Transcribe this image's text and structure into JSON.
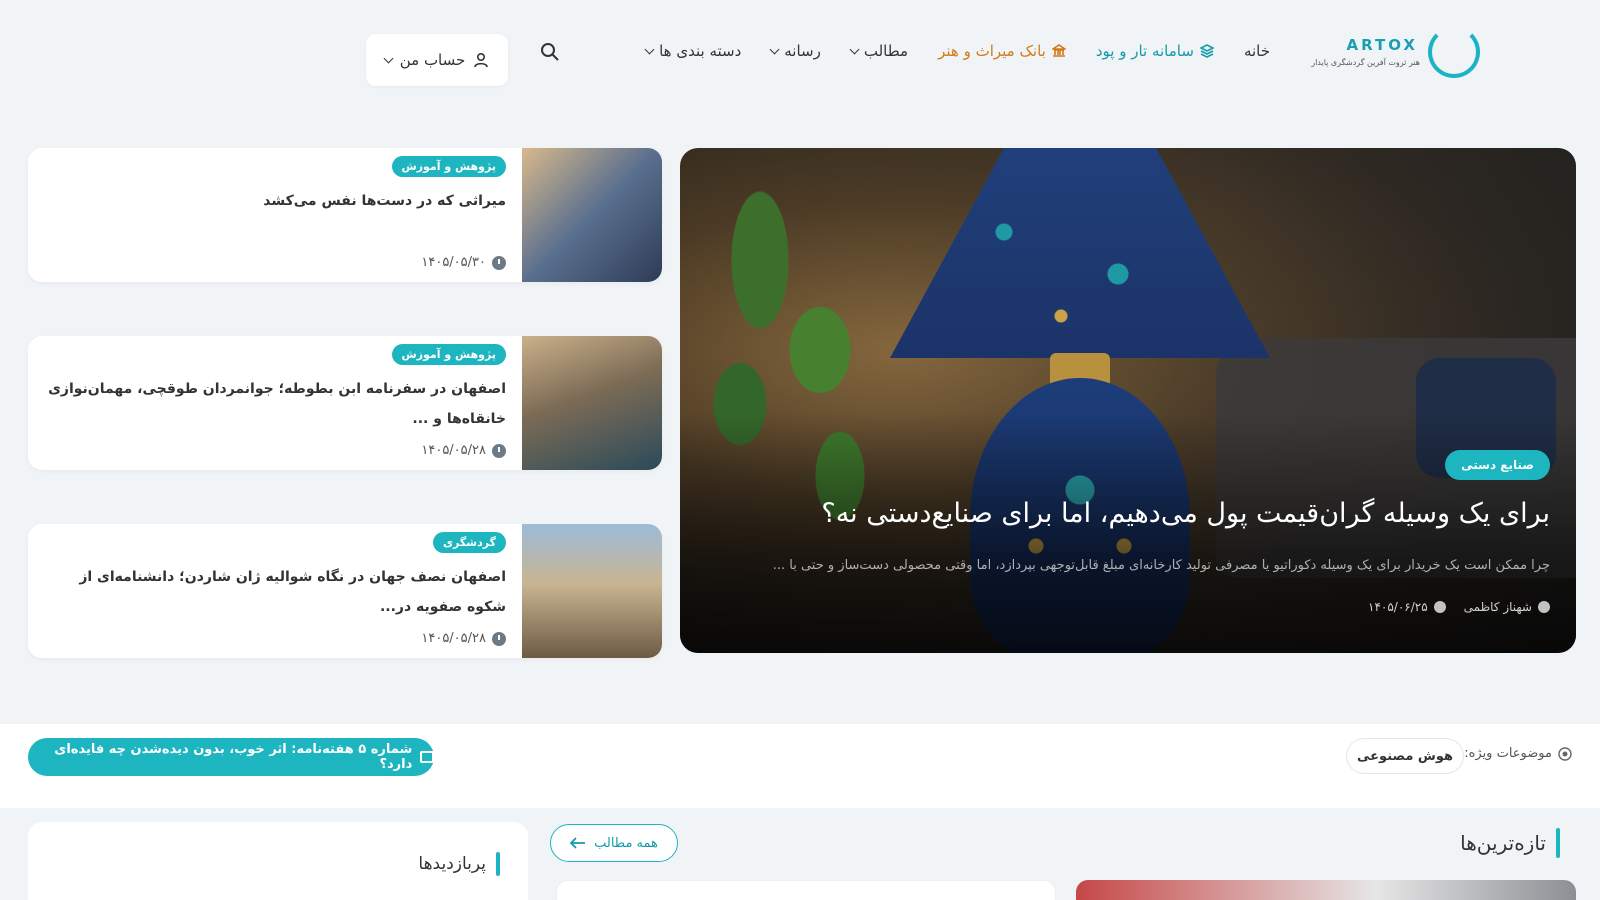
{
  "header": {
    "logo_word": "ARTOX",
    "logo_tagline": "هنر ثروت آفرین گردشگری پایدار",
    "nav": [
      {
        "label": "خانه"
      },
      {
        "label": "سامانه تار و پود"
      },
      {
        "label": "بانک میراث و هنر"
      },
      {
        "label": "مطالب"
      },
      {
        "label": "رسانه"
      },
      {
        "label": "دسته بندی ها"
      }
    ],
    "account_label": "حساب من"
  },
  "hero": {
    "badge": "صنایع دستی",
    "title": "برای یک وسیله گران‌قیمت پول می‌دهیم، اما برای صنایع‌دستی نه؟",
    "excerpt": "چرا ممکن است یک خریدار برای یک وسیله دکوراتیو یا مصرفی تولید کارخانه‌ای مبلغ قابل‌توجهی بپردازد، اما وقتی محصولی دست‌ساز و حتی با ...",
    "author": "شهناز کاظمی",
    "date": "۱۴۰۵/۰۶/۲۵"
  },
  "side_posts": [
    {
      "badge": "پژوهش و آموزش",
      "title": "میراثی که در دست‌ها نفس می‌کشد",
      "date": "۱۴۰۵/۰۵/۳۰"
    },
    {
      "badge": "پژوهش و آموزش",
      "title": "اصفهان در سفرنامه ابن بطوطه؛ جوانمردان طوقچی، مهمان‌نوازی خانقاه‌ها و ...",
      "date": "۱۴۰۵/۰۵/۲۸"
    },
    {
      "badge": "گردشگری",
      "title": "اصفهان نصف جهان در نگاه شوالیه ژان شاردن؛ دانشنامه‌ای از شکوه صفویه در...",
      "date": "۱۴۰۵/۰۵/۲۸"
    }
  ],
  "topics": {
    "label": "موضوعات ویژه:",
    "chip": "هوش مصنوعی",
    "newsletter": "شماره ۵ هفته‌نامه: اثر خوب، بدون دیده‌شدن چه فایده‌ای دارد؟"
  },
  "latest": {
    "title": "تازه‌ترین‌ها",
    "all_posts": "همه مطالب"
  },
  "most_viewed": {
    "title": "پربازدیدها"
  },
  "colors": {
    "accent": "#1cb5c0",
    "orange": "#d27a1a",
    "teal_text": "#149aa8",
    "bg": "#f1f4f7"
  }
}
